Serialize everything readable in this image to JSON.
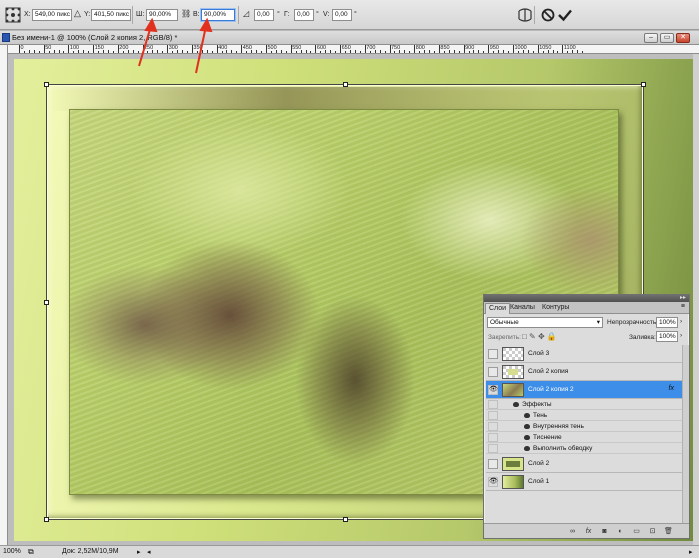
{
  "options_bar": {
    "x_label": "X:",
    "x_value": "549,00 пикс",
    "y_label": "Y:",
    "y_value": "401,50 пикс",
    "w_label": "Ш:",
    "w_value": "90,00%",
    "h_label": "В:",
    "h_value": "90,00%",
    "rotate_value": "0,00",
    "h_skew_label": "Г:",
    "h_skew_value": "0,00",
    "v_skew_label": "V:",
    "v_skew_value": "0,00"
  },
  "document": {
    "tab_title": "Без имени-1 @ 100% (Слой 2 копия 2, RGB/8) *",
    "ruler_ticks": [
      "0",
      "50",
      "100",
      "150",
      "200",
      "250",
      "300",
      "350",
      "400",
      "450",
      "500",
      "550",
      "600",
      "650",
      "700",
      "750",
      "800",
      "850",
      "900",
      "950",
      "1000",
      "1050",
      "1100"
    ]
  },
  "status": {
    "zoom": "100%",
    "doc_size": "Док: 2,52M/10,9M"
  },
  "layers_panel": {
    "tabs": [
      "Слои",
      "Каналы",
      "Контуры"
    ],
    "blend_mode": "Обычные",
    "opacity_label": "Непрозрачность:",
    "opacity_value": "100%",
    "lock_label": "Закрепить:",
    "fill_label": "Заливка:",
    "fill_value": "100%",
    "layers": [
      {
        "name": "Слой 3",
        "visible": false
      },
      {
        "name": "Слой 2 копия",
        "visible": false
      },
      {
        "name": "Слой 2 копия 2",
        "visible": true,
        "selected": true
      },
      {
        "name": "Слой 2",
        "visible": false
      },
      {
        "name": "Слой 1",
        "visible": true
      }
    ],
    "fx_label": "fx",
    "effects_header": "Эффекты",
    "effects": [
      "Тень",
      "Внутренняя тень",
      "Тиснение",
      "Выполнить обводку"
    ]
  },
  "colors": {
    "selected_layer": "#3d8ee8",
    "annotation_arrow": "#e0301e"
  }
}
